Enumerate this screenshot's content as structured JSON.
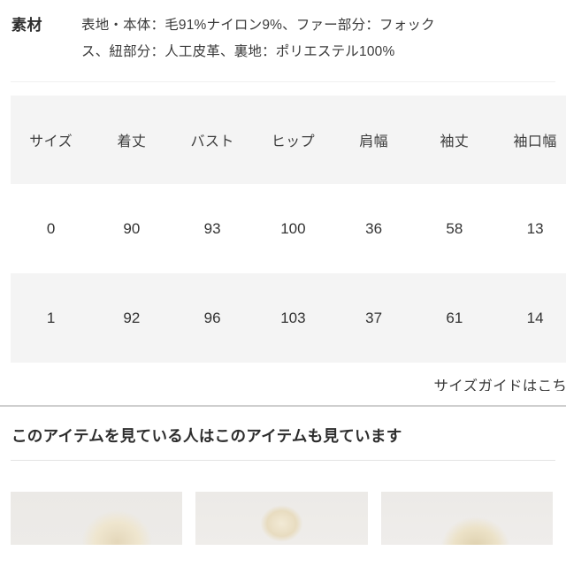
{
  "spec": {
    "label": "素材",
    "lines": [
      "表地・本体：毛91%ナイロン9%、ファー部分：フォック",
      "ス、紐部分：人工皮革、裏地：ポリエステル100%"
    ]
  },
  "size_table": {
    "headers": [
      "サイズ",
      "着丈",
      "バスト",
      "ヒップ",
      "肩幅",
      "袖丈",
      "袖口幅",
      ""
    ],
    "rows": [
      [
        "0",
        "90",
        "93",
        "100",
        "36",
        "58",
        "13",
        ""
      ],
      [
        "1",
        "92",
        "96",
        "103",
        "37",
        "61",
        "14",
        ""
      ]
    ]
  },
  "size_guide": {
    "link_label": "サイズガイドはこちら"
  },
  "recommendations": {
    "title": "このアイテムを見ている人はこのアイテムも見ています",
    "items": [
      {
        "alt": "product-thumbnail-1"
      },
      {
        "alt": "product-thumbnail-2"
      },
      {
        "alt": "product-thumbnail-3"
      }
    ]
  },
  "colors": {
    "text": "#333333",
    "header_band": "#f4f4f4",
    "divider_light": "#efefef",
    "divider_strong": "#cfcfcf"
  }
}
